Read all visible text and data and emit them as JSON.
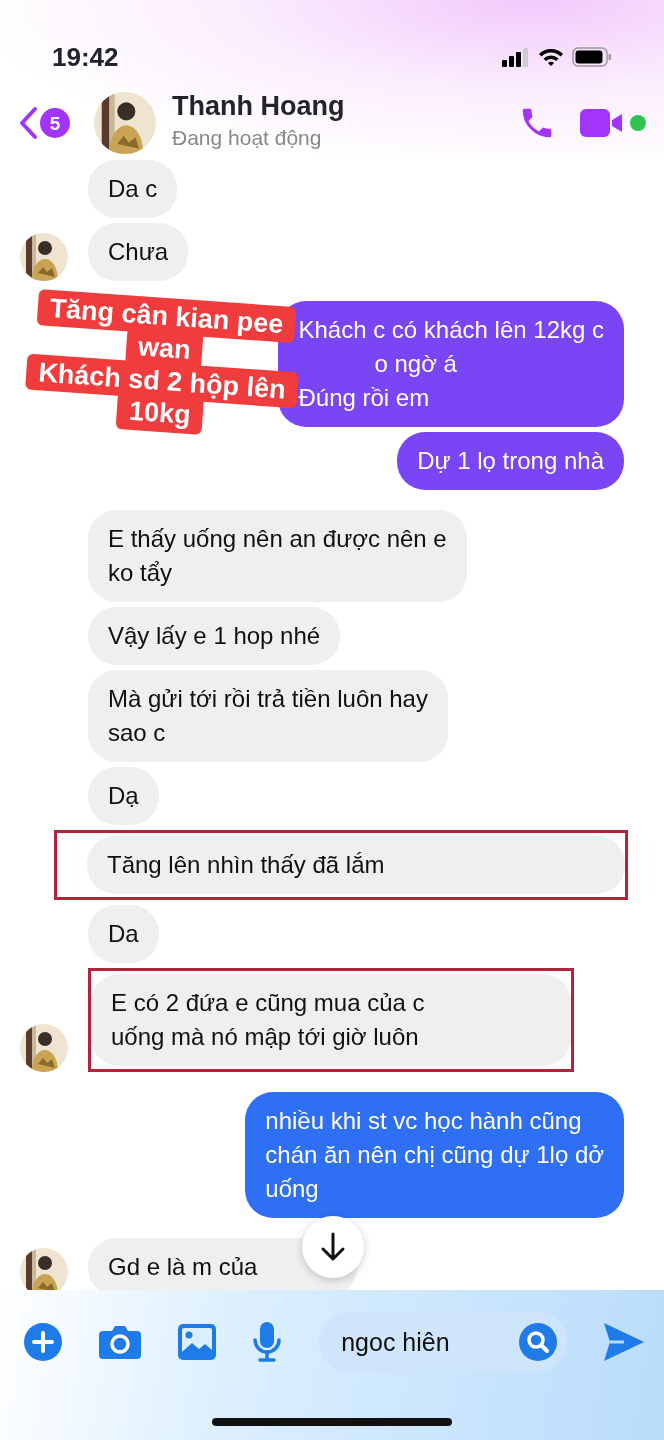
{
  "status_bar": {
    "time": "19:42"
  },
  "header": {
    "back_count": "5",
    "name": "Thanh Hoang",
    "status": "Đang hoạt động",
    "online": true
  },
  "messages": [
    {
      "kind": "received",
      "avatar": false,
      "highlighted": false,
      "lines": [
        {
          "text": "Da c"
        }
      ]
    },
    {
      "kind": "received",
      "avatar": true,
      "highlighted": false,
      "lines": [
        {
          "text": "Chưa"
        }
      ]
    },
    {
      "kind": "sent",
      "color": "#7a45f4",
      "highlighted": false,
      "lines": [
        {
          "text": "Khách c có khách lên 12kg c"
        },
        {
          "text": "o ngờ á",
          "covered": true
        },
        {
          "text": "Đúng rồi em"
        }
      ]
    },
    {
      "kind": "sent",
      "color": "#7a45f4",
      "highlighted": false,
      "lines": [
        {
          "text": "Dự 1 lọ trong nhà"
        }
      ]
    },
    {
      "kind": "received",
      "avatar": false,
      "highlighted": false,
      "lines": [
        {
          "text": "E thấy uống nên an được nên e"
        },
        {
          "text": "ko tẩy"
        }
      ]
    },
    {
      "kind": "received",
      "avatar": false,
      "highlighted": false,
      "lines": [
        {
          "text": "Vậy lấy e 1 hop nhé"
        }
      ]
    },
    {
      "kind": "received",
      "avatar": false,
      "highlighted": false,
      "lines": [
        {
          "text": "Mà gửi tới rồi trả tiền luôn hay"
        },
        {
          "text": "sao c"
        }
      ]
    },
    {
      "kind": "received",
      "avatar": false,
      "highlighted": false,
      "lines": [
        {
          "text": "Dạ"
        }
      ]
    },
    {
      "kind": "received",
      "avatar": false,
      "highlighted": true,
      "lines": [
        {
          "text": "Tăng lên nhìn thấy đã lắm"
        }
      ]
    },
    {
      "kind": "received",
      "avatar": false,
      "highlighted": false,
      "lines": [
        {
          "text": "Da"
        }
      ]
    },
    {
      "kind": "received",
      "avatar": true,
      "highlighted": true,
      "lines": [
        {
          "text": "E có 2 đứa e cũng mua của c"
        },
        {
          "text": "uống mà nó mập tới giờ luôn"
        }
      ]
    },
    {
      "kind": "sent",
      "color": "#2f6ff3",
      "highlighted": false,
      "lines": [
        {
          "text": "nhiều khi st vc học hành cũng"
        },
        {
          "text": "chán ăn nên chị cũng dự 1lọ dở"
        },
        {
          "text": "uống"
        }
      ]
    },
    {
      "kind": "received",
      "avatar": true,
      "highlighted": false,
      "lines": [
        {
          "text": "Gd  e là m của",
          "covered": true
        }
      ]
    }
  ],
  "sticker": {
    "lines": [
      "Tăng cân kian pee",
      "wan",
      "Khách sd 2 hộp lên",
      "10kg"
    ]
  },
  "composer": {
    "value": "ngoc hiên"
  }
}
